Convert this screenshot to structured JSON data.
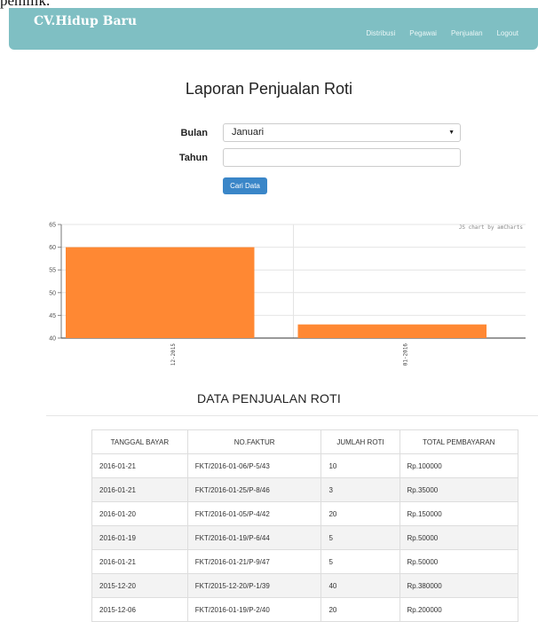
{
  "top_fragment": "pemilik.",
  "navbar": {
    "brand": "CV.Hidup Baru",
    "items": [
      "Distribusi",
      "Pegawai",
      "Penjualan",
      "Logout"
    ]
  },
  "page": {
    "title": "Laporan Penjualan Roti",
    "form": {
      "bulan_label": "Bulan",
      "bulan_value": "Januari",
      "tahun_label": "Tahun",
      "tahun_value": "",
      "button": "Cari Data"
    },
    "section_title": "DATA PENJUALAN ROTI"
  },
  "chart_data": {
    "type": "bar",
    "categories": [
      "12-2015",
      "01-2016"
    ],
    "values": [
      60,
      43
    ],
    "ylim": [
      40,
      65
    ],
    "yticks": [
      40,
      45,
      50,
      55,
      60,
      65
    ],
    "bar_color": "#ff8833",
    "credit": "JS chart by amCharts",
    "grid": true
  },
  "table": {
    "headers": [
      "TANGGAL BAYAR",
      "NO.FAKTUR",
      "JUMLAH ROTI",
      "TOTAL PEMBAYARAN"
    ],
    "rows": [
      [
        "2016-01-21",
        "FKT/2016-01-06/P-5/43",
        "10",
        "Rp.100000"
      ],
      [
        "2016-01-21",
        "FKT/2016-01-25/P-8/46",
        "3",
        "Rp.35000"
      ],
      [
        "2016-01-20",
        "FKT/2016-01-05/P-4/42",
        "20",
        "Rp.150000"
      ],
      [
        "2016-01-19",
        "FKT/2016-01-19/P-6/44",
        "5",
        "Rp.50000"
      ],
      [
        "2016-01-21",
        "FKT/2016-01-21/P-9/47",
        "5",
        "Rp.50000"
      ],
      [
        "2015-12-20",
        "FKT/2015-12-20/P-1/39",
        "40",
        "Rp.380000"
      ],
      [
        "2015-12-06",
        "FKT/2016-01-19/P-2/40",
        "20",
        "Rp.200000"
      ]
    ]
  },
  "colors": {
    "navbar": "#7fbfc3",
    "button": "#3a86c8",
    "bar": "#ff8833"
  }
}
